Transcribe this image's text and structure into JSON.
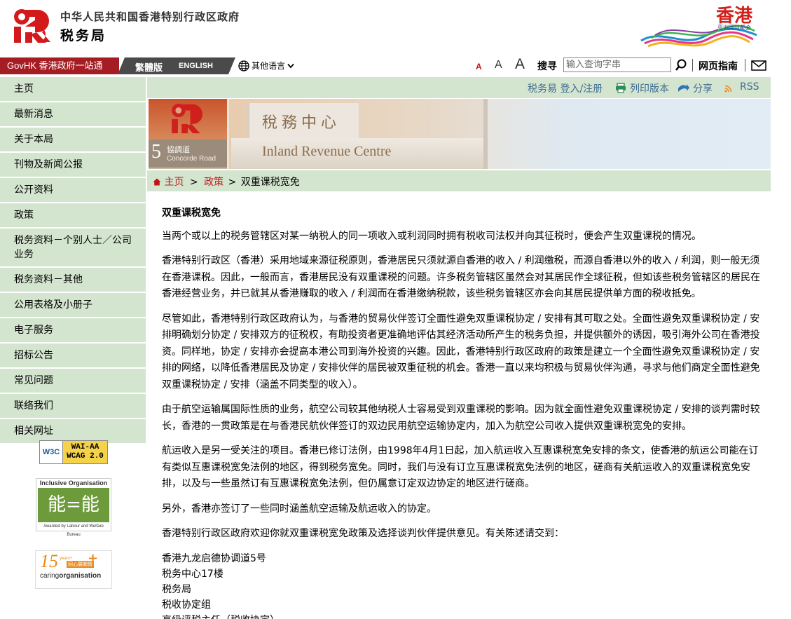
{
  "header": {
    "gov_name": "中华人民共和国香港特别行政区政府",
    "dept_name": "税务局",
    "brand_title": "香港",
    "brand_subtitle": "亚洲国际都会"
  },
  "govbar": {
    "govhk": "GovHK 香港政府一站通",
    "trad": "繁體版",
    "english": "ENGLISH",
    "other_lang": "其他语言",
    "font_small": "A",
    "font_medium": "A",
    "font_large": "A",
    "search_label": "搜寻",
    "search_placeholder": "输入查询字串",
    "guide": "网页指南"
  },
  "sidebar": {
    "items": [
      {
        "label": "主页"
      },
      {
        "label": "最新消息"
      },
      {
        "label": "关于本局"
      },
      {
        "label": "刊物及新闻公报"
      },
      {
        "label": "公开资料"
      },
      {
        "label": "政策"
      },
      {
        "label": "税务资料－个别人士／公司业务"
      },
      {
        "label": "税务资料－其他"
      },
      {
        "label": "公用表格及小册子"
      },
      {
        "label": "电子服务"
      },
      {
        "label": "招标公告"
      },
      {
        "label": "常见问题"
      },
      {
        "label": "联络我们"
      },
      {
        "label": "相关网址"
      }
    ],
    "badges": {
      "wcag_w3c": "W3C",
      "wcag_level": "WAI-AA",
      "wcag_version": "WCAG 2.0",
      "inclusive_title": "Inclusive Organisation",
      "inclusive_mark": "能=能",
      "inclusive_footer": "Awarded by Labour and Welfare Bureau",
      "caring_years": "15",
      "caring_years_suffix": "years+",
      "caring_cn": "同心展關懷",
      "caring_name_a": "caring",
      "caring_name_b": "organisation"
    }
  },
  "utility": {
    "etax": "税务易 登入/注册",
    "print": "列印版本",
    "share": "分享",
    "rss": "RSS"
  },
  "banner": {
    "address_num": "5",
    "address_cn": "協調道",
    "address_en": "Concorde Road",
    "sign_cn": "稅務中心",
    "sign_en": "Inland Revenue Centre"
  },
  "breadcrumb": {
    "home": "主页",
    "sep1": ">",
    "policy": "政策",
    "sep2": ">",
    "current": "双重课税宽免"
  },
  "content": {
    "title": "双重课税宽免",
    "paragraphs": [
      "当两个或以上的税务管辖区对某一纳税人的同一项收入或利润同时拥有税收司法权并向其征税时，便会产生双重课税的情况。",
      "香港特别行政区（香港）采用地域来源征税原则，香港居民只须就源自香港的收入 / 利润缴税，而源自香港以外的收入 / 利润，则一般无须在香港课税。因此，一般而言，香港居民没有双重课税的问题。许多税务管辖区虽然会对其居民作全球征税，但如该些税务管辖区的居民在香港经营业务，并已就其从香港赚取的收入 / 利润而在香港缴纳税款，该些税务管辖区亦会向其居民提供单方面的税收抵免。",
      "尽管如此，香港特别行政区政府认为，与香港的贸易伙伴签订全面性避免双重课税协定 / 安排有其可取之处。全面性避免双重课税协定 / 安排明确划分协定 / 安排双方的征税权，有助投资者更准确地评估其经济活动所产生的税务负担，并提供额外的诱因，吸引海外公司在香港投资。同样地，协定 / 安排亦会提高本港公司到海外投资的兴趣。因此，香港特别行政区政府的政策是建立一个全面性避免双重课税协定 / 安排的网络，以降低香港居民及协定 / 安排伙伴的居民被双重征税的机会。香港一直以来均积极与贸易伙伴沟通，寻求与他们商定全面性避免双重课税协定 / 安排（涵盖不同类型的收入）。",
      "由于航空运输属国际性质的业务，航空公司较其他纳税人士容易受到双重课税的影响。因为就全面性避免双重课税协定 / 安排的谈判需时较长，香港的一贯政策是在与香港民航伙伴签订的双边民用航空运输协定内，加入为航空公司收入提供双重课税宽免的安排。",
      "航运收入是另一受关注的项目。香港已修订法例，由1998年4月1日起，加入航运收入互惠课税宽免安排的条文，使香港的航运公司能在订有类似互惠课税宽免法例的地区，得到税务宽免。同时，我们与没有订立互惠课税宽免法例的地区，磋商有关航运收入的双重课税宽免安排，以及与一些虽然订有互惠课税宽免法例，但仍属意订定双边协定的地区进行磋商。",
      "另外，香港亦签订了一些同时涵盖航空运输及航运收入的协定。",
      "香港特别行政区政府欢迎你就双重课税宽免政策及选择谈判伙伴提供意见。有关陈述请交到："
    ],
    "address": [
      "香港九龙启德协调道5号",
      "税务中心17楼",
      "税务局",
      "税收协定组",
      "高级评税主任（税收协定）"
    ]
  },
  "colors": {
    "govhk_red": "#a51d22",
    "nav_green": "#d4e5cf",
    "link_blue": "#3f6b94",
    "crumb_red": "#c0141a"
  }
}
